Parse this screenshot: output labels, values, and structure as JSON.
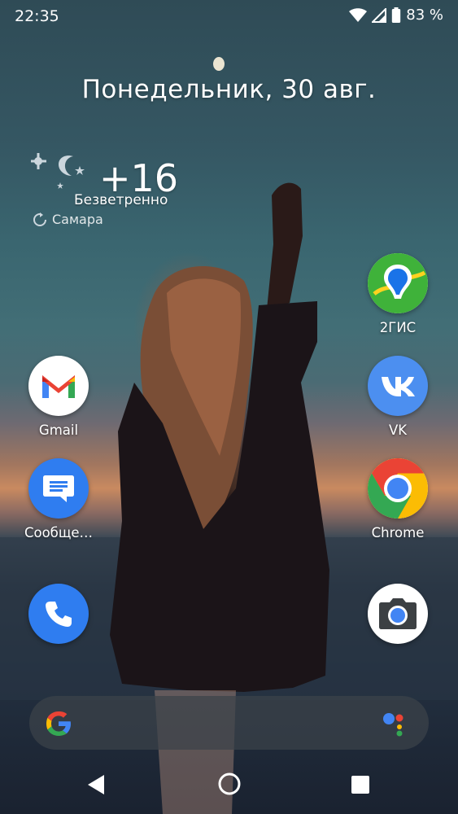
{
  "status_bar": {
    "time": "22:35",
    "battery_percent": "83 %"
  },
  "date_widget": {
    "text": "Понедельник, 30 авг."
  },
  "weather": {
    "temperature": "+16",
    "condition": "Безветренно",
    "city": "Самара"
  },
  "apps": {
    "gis2": {
      "label": "2ГИС",
      "icon": "2gis-icon"
    },
    "gmail": {
      "label": "Gmail",
      "icon": "gmail-icon"
    },
    "vk": {
      "label": "VK",
      "icon": "vk-icon"
    },
    "messages": {
      "label": "Сообще…",
      "icon": "messages-icon"
    },
    "chrome": {
      "label": "Chrome",
      "icon": "chrome-icon"
    },
    "phone": {
      "icon": "phone-icon"
    },
    "camera": {
      "icon": "camera-icon"
    }
  },
  "search_bar": {
    "icons": [
      "google-logo-icon",
      "assistant-icon"
    ]
  },
  "nav_bar": {
    "buttons": [
      "back",
      "home",
      "recents"
    ]
  },
  "colors": {
    "gis_green": "#3fb23a",
    "gmail_red": "#ea4335",
    "vk_blue": "#4c8ff0",
    "messages_blue": "#2f7df0",
    "phone_blue": "#2f7df0"
  }
}
